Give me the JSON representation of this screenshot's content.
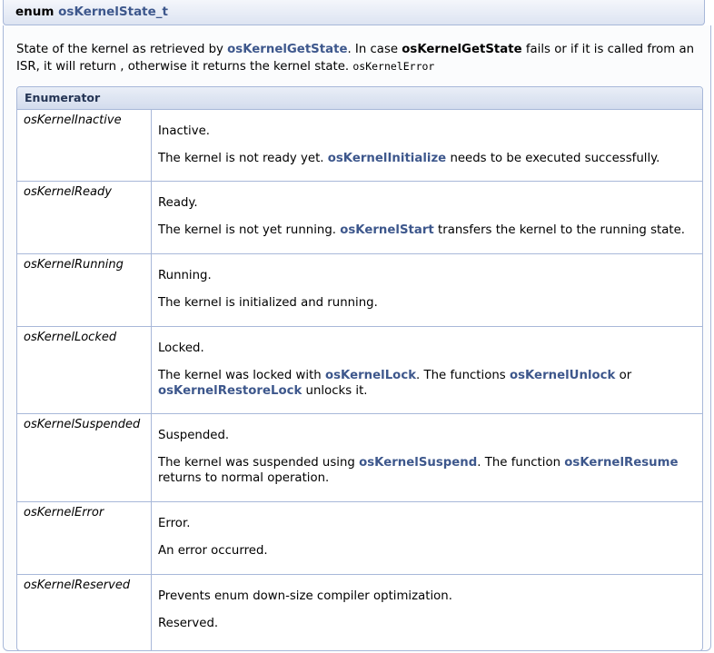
{
  "title": {
    "keyword": "enum",
    "name": "osKernelState_t"
  },
  "description": {
    "p1": "State of the kernel as retrieved by ",
    "link1": "osKernelGetState",
    "p2": ". In case ",
    "bold1": "osKernelGetState",
    "p3": " fails or if it is called from an ISR, it will return , otherwise it returns the kernel state. ",
    "code1": "osKernelError"
  },
  "enumerator_header": "Enumerator",
  "enumerators": [
    {
      "name": "osKernelInactive",
      "brief": "Inactive.",
      "detail": [
        {
          "t": "text",
          "v": "The kernel is not ready yet. "
        },
        {
          "t": "link",
          "v": "osKernelInitialize"
        },
        {
          "t": "text",
          "v": " needs to be executed successfully."
        }
      ]
    },
    {
      "name": "osKernelReady",
      "brief": "Ready.",
      "detail": [
        {
          "t": "text",
          "v": "The kernel is not yet running. "
        },
        {
          "t": "link",
          "v": "osKernelStart"
        },
        {
          "t": "text",
          "v": " transfers the kernel to the running state."
        }
      ]
    },
    {
      "name": "osKernelRunning",
      "brief": "Running.",
      "detail": [
        {
          "t": "text",
          "v": "The kernel is initialized and running."
        }
      ]
    },
    {
      "name": "osKernelLocked",
      "brief": "Locked.",
      "detail": [
        {
          "t": "text",
          "v": "The kernel was locked with "
        },
        {
          "t": "link",
          "v": "osKernelLock"
        },
        {
          "t": "text",
          "v": ". The functions "
        },
        {
          "t": "link",
          "v": "osKernelUnlock"
        },
        {
          "t": "text",
          "v": " or "
        },
        {
          "t": "link",
          "v": "osKernelRestoreLock"
        },
        {
          "t": "text",
          "v": " unlocks it."
        }
      ]
    },
    {
      "name": "osKernelSuspended",
      "brief": "Suspended.",
      "detail": [
        {
          "t": "text",
          "v": "The kernel was suspended using "
        },
        {
          "t": "link",
          "v": "osKernelSuspend"
        },
        {
          "t": "text",
          "v": ". The function "
        },
        {
          "t": "link",
          "v": "osKernelResume"
        },
        {
          "t": "text",
          "v": " returns to normal operation."
        }
      ]
    },
    {
      "name": "osKernelError",
      "brief": "Error.",
      "detail": [
        {
          "t": "text",
          "v": "An error occurred."
        }
      ]
    },
    {
      "name": "osKernelReserved",
      "brief": "Prevents enum down-size compiler optimization.",
      "detail": [
        {
          "t": "text",
          "v": "Reserved."
        }
      ]
    }
  ]
}
